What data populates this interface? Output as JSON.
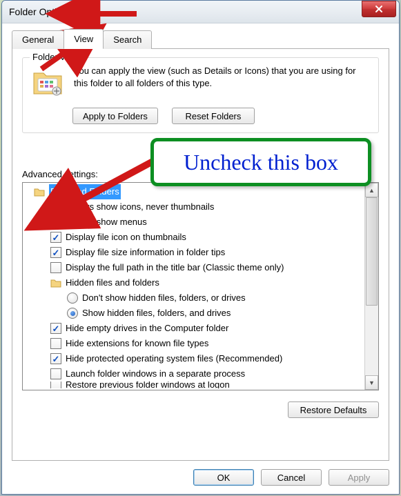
{
  "window": {
    "title": "Folder Options"
  },
  "tabs": {
    "general": "General",
    "view": "View",
    "search": "Search"
  },
  "folder_views": {
    "group_title": "Folder views",
    "description": "You can apply the view (such as Details or Icons) that you are using for this folder to all folders of this type.",
    "apply_btn": "Apply to Folders",
    "reset_btn": "Reset Folders"
  },
  "adv": {
    "label": "Advanced settings:",
    "root": "Files and Folders",
    "items": [
      {
        "type": "check",
        "checked": false,
        "label": "Always show icons, never thumbnails"
      },
      {
        "type": "check",
        "checked": false,
        "label": "Always show menus"
      },
      {
        "type": "check",
        "checked": true,
        "label": "Display file icon on thumbnails"
      },
      {
        "type": "check",
        "checked": true,
        "label": "Display file size information in folder tips"
      },
      {
        "type": "check",
        "checked": false,
        "label": "Display the full path in the title bar (Classic theme only)"
      },
      {
        "type": "folder",
        "label": "Hidden files and folders"
      },
      {
        "type": "radio",
        "selected": false,
        "label": "Don't show hidden files, folders, or drives",
        "indent": 3
      },
      {
        "type": "radio",
        "selected": true,
        "label": "Show hidden files, folders, and drives",
        "indent": 3
      },
      {
        "type": "check",
        "checked": true,
        "label": "Hide empty drives in the Computer folder"
      },
      {
        "type": "check",
        "checked": false,
        "label": "Hide extensions for known file types"
      },
      {
        "type": "check",
        "checked": true,
        "label": "Hide protected operating system files (Recommended)"
      },
      {
        "type": "check",
        "checked": false,
        "label": "Launch folder windows in a separate process"
      },
      {
        "type": "check",
        "checked": false,
        "label": "Restore previous folder windows at logon",
        "cut": true
      }
    ]
  },
  "buttons": {
    "restore": "Restore Defaults",
    "ok": "OK",
    "cancel": "Cancel",
    "apply": "Apply"
  },
  "annotation": {
    "callout": "Uncheck this box"
  }
}
